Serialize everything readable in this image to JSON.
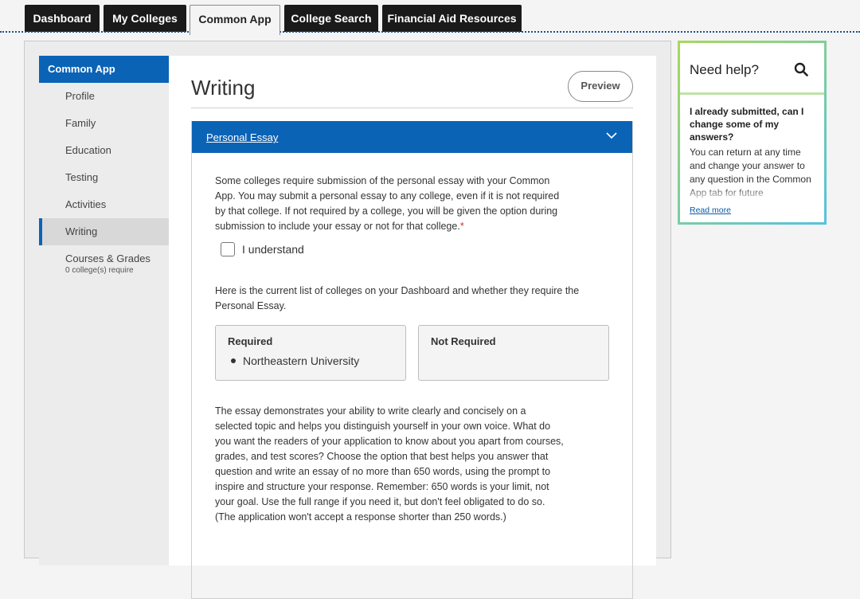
{
  "top_tabs": [
    "Dashboard",
    "My Colleges",
    "Common App",
    "College Search",
    "Financial Aid Resources"
  ],
  "sidebar": {
    "header": "Common App",
    "items": [
      {
        "label": "Profile"
      },
      {
        "label": "Family"
      },
      {
        "label": "Education"
      },
      {
        "label": "Testing"
      },
      {
        "label": "Activities"
      },
      {
        "label": "Writing"
      },
      {
        "label": "Courses & Grades",
        "sub": "0 college(s) require"
      }
    ]
  },
  "main": {
    "title": "Writing",
    "preview_label": "Preview",
    "section_title": "Personal Essay",
    "intro": "Some colleges require submission of the personal essay with your Common App. You may submit a personal essay to any college, even if it is not required by that college. If not required by a college, you will be given the option during submission to include your essay or not for that college.",
    "required_star": "*",
    "understand_label": "I understand",
    "list_intro": "Here is the current list of colleges on your Dashboard and whether they require the Personal Essay.",
    "required_title": "Required",
    "required_items": [
      "Northeastern University"
    ],
    "not_required_title": "Not Required",
    "essay_text": "The essay demonstrates your ability to write clearly and concisely on a selected topic and helps you distinguish yourself in your own voice. What do you want the readers of your application to know about you apart from courses, grades, and test scores? Choose the option that best helps you answer that question and write an essay of no more than 650 words, using the prompt to inspire and structure your response. Remember: 650 words is your limit, not your goal. Use the full range if you need it, but don't feel obligated to do so. (The application won't accept a response shorter than 250 words.)"
  },
  "help": {
    "title": "Need help?",
    "question": "I already submitted, can I change some of my answers?",
    "answer": "You can return at any time and change your answer to any question in the Common App tab for future",
    "read_more": "Read more"
  },
  "colors": {
    "accent": "#0b63b6",
    "help_border_start": "#a8d85c",
    "help_border_end": "#55c2e0"
  }
}
